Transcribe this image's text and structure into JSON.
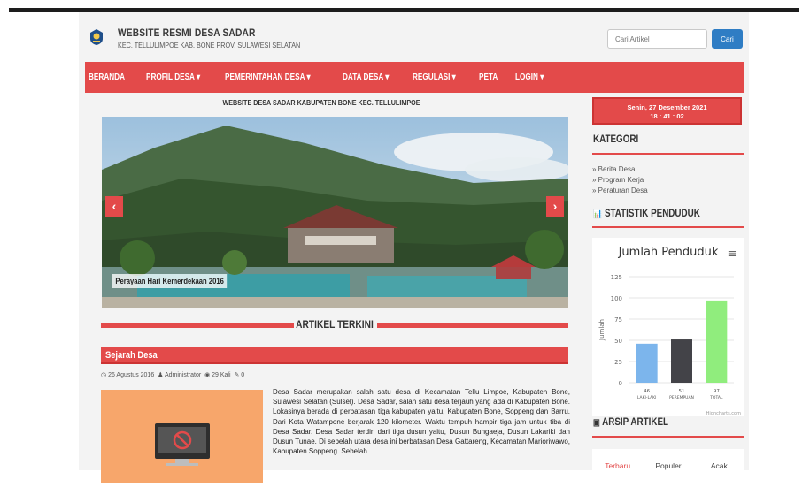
{
  "header": {
    "title": "WEBSITE RESMI DESA SADAR",
    "subtitle": "KEC. TELLULIMPOE KAB. BONE PROV. SULAWESI SELATAN",
    "search_placeholder": "Cari Artikel",
    "search_button": "Cari"
  },
  "nav": {
    "items": [
      "BERANDA",
      "PROFIL DESA ▾",
      "PEMERINTAHAN DESA ▾",
      "DATA DESA ▾",
      "REGULASI ▾",
      "PETA",
      "LOGIN ▾"
    ]
  },
  "slider": {
    "title": "WEBSITE DESA SADAR KABUPATEN BONE KEC. TELLULIMPOE",
    "caption": "Perayaan Hari Kemerdekaan 2016",
    "prev_icon": "chevron-left-icon",
    "next_icon": "chevron-right-icon"
  },
  "articles": {
    "section_title": "ARTIKEL TERKINI",
    "first": {
      "title": "Sejarah Desa",
      "date": "26 Agustus 2016",
      "author": "Administrator",
      "views": "29 Kali",
      "comments": "0",
      "text": "Desa Sadar merupakan salah satu desa di Kecamatan Tellu Limpoe, Kabupaten Bone, Sulawesi Selatan (Sulsel). Desa Sadar, salah satu desa terjauh yang ada di Kabupaten Bone. Lokasinya berada di perbatasan tiga kabupaten yaitu, Kabupaten Bone, Soppeng dan Barru. Dari Kota Watampone berjarak 120 kilometer. Waktu tempuh hampir tiga jam untuk tiba di Desa Sadar. Desa Sadar terdiri dari tiga dusun yaitu, Dusun Bungaeja, Dusun Lakariki dan Dusun Tunae. Di sebelah utara desa ini berbatasan Desa Gattareng, Kecamatan Marioriwawo, Kabupaten Soppeng. Sebelah"
    }
  },
  "sidebar": {
    "date_line": "Senin, 27 Desember 2021",
    "time_line": "18 : 41 : 02",
    "kategori_title": "KATEGORI",
    "kategori_items": [
      "» Berita Desa",
      "» Program Kerja",
      "» Peraturan Desa"
    ],
    "statistik_title": "STATISTIK PENDUDUK",
    "arsip_title": "ARSIP ARTIKEL",
    "tabs": [
      "Terbaru",
      "Populer",
      "Acak"
    ],
    "chart_menu_icon": "hamburger-menu-icon",
    "chart_credit": "Highcharts.com"
  },
  "chart_data": {
    "type": "bar",
    "title": "Jumlah Penduduk",
    "ylabel": "Jumlah",
    "xlabel": "",
    "categories": [
      "LAKI-LAKI",
      "PEREMPUAN",
      "TOTAL"
    ],
    "values": [
      46,
      51,
      97
    ],
    "value_labels": [
      "46",
      "51",
      "97"
    ],
    "yticks": [
      0,
      25,
      50,
      75,
      100,
      125
    ],
    "ylim": [
      0,
      125
    ],
    "colors": [
      "#7cb5ec",
      "#434348",
      "#90ed7d"
    ],
    "grid": true
  }
}
